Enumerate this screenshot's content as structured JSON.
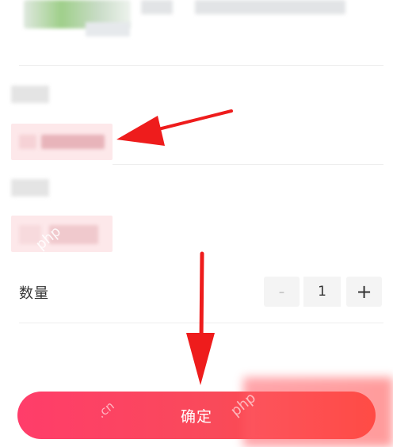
{
  "options": {
    "quantity_label": "数量",
    "minus_label": "-",
    "quantity_value": "1",
    "plus_label": "+"
  },
  "footer": {
    "confirm_label": "确定"
  },
  "watermark": {
    "site": "php",
    "domain": ".cn"
  },
  "colors": {
    "arrow": "#ee1c1c",
    "confirm_start": "#ff3d6a",
    "confirm_end": "#ff4b3c",
    "option_chip_bg": "#fde8ea"
  }
}
